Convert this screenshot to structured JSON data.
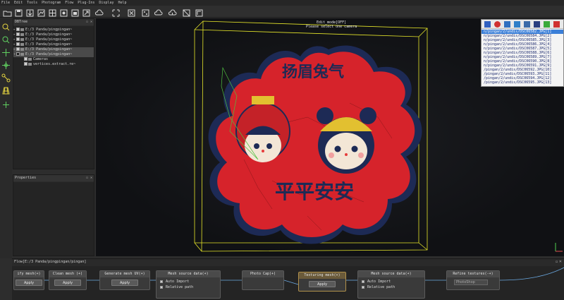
{
  "menu": [
    "File",
    "Edit",
    "Tools",
    "Photogram",
    "Flow",
    "Plug-Ins",
    "Display",
    "Help"
  ],
  "toolbar": {
    "icons": [
      "open-folder-icon",
      "save-icon",
      "import-icon",
      "layers-icon",
      "grid-icon",
      "camera-icon",
      "cloud-icon",
      "download-icon",
      "cloud-upload-icon",
      "cloud-sync-icon",
      "mesh-icon",
      "texture-icon",
      "expand-icon"
    ]
  },
  "tools": [
    "search-icon",
    "zoom-icon",
    "move-icon",
    "crosshair-icon",
    "nodes-icon",
    "grid-icon",
    "snap-icon"
  ],
  "dbtree": {
    "title": "DBTree",
    "rows": [
      {
        "label": "E:/3 Panda/pingpingan~"
      },
      {
        "label": "E:/3 Panda/pingpingan~"
      },
      {
        "label": "E:/3 Panda/pingpingan~"
      },
      {
        "label": "E:/3 Panda/pingpingan~"
      },
      {
        "label": "E:/3 Panda/pingpingan~"
      },
      {
        "label": "E:/3 Panda/pingpingan~"
      },
      {
        "label": "Cameras"
      },
      {
        "label": "vertices.extract.re~"
      }
    ]
  },
  "properties": {
    "title": "Properties"
  },
  "viewport": {
    "mode_label": "Edit_mode[OFF]",
    "hint": "Please select one camera",
    "patch_top_text": "扬眉兔气",
    "patch_bottom_text": "平平安安"
  },
  "camera_list": {
    "items": [
      "n/pingan/2/undis/DSC06582.JPG[1]",
      "n/pingan/2/undis/DSC06584.JPG[2]",
      "n/pingan/2/undis/DSC06585.JPG[3]",
      "n/pingan/2/undis/DSC06586.JPG[4]",
      "n/pingan/2/undis/DSC06587.JPG[5]",
      "n/pingan/2/undis/DSC06588.JPG[6]",
      "n/pingan/2/undis/DSC06589.JPG[7]",
      "n/pingan/2/undis/DSC06590.JPG[8]",
      "n/pingan/2/undis/DSC06591.JPG[9]",
      "/pingan/2/undis/DSC06592.JPG[10]",
      "/pingan/2/undis/DSC06593.JPG[11]",
      "/pingan/2/undis/DSC06594.JPG[12]",
      "/pingan/2/undis/DSC06595.JPG[13]"
    ]
  },
  "flow": {
    "title": "Flow[E:/3 Panda/pingpingan/pingan]",
    "nodes": [
      {
        "title": "ify mesh(+)",
        "apply": "Apply"
      },
      {
        "title": "Clean mesh (+)",
        "apply": "Apply"
      },
      {
        "title": "Generate mesh UV(+)",
        "apply": "Apply"
      },
      {
        "title": "Mesh source data(+)",
        "opt1": "Auto Import",
        "opt2": "Relative path"
      },
      {
        "title": "Photo Cap(+)"
      },
      {
        "title": "Texturing mesh(+)",
        "apply": "Apply"
      },
      {
        "title": "Mesh source data(+)",
        "opt1": "Auto Import",
        "opt2": "Relative path"
      },
      {
        "title": "Refine textures(-+)",
        "combo": "PhotoShop"
      }
    ]
  },
  "colors": {
    "patch_red": "#d6232b",
    "patch_border": "#1d2a55",
    "bbox_yellow": "#e6e62a",
    "selection_blue": "#3b7fd8"
  }
}
